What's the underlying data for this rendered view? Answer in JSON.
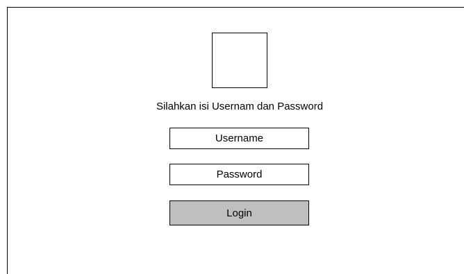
{
  "login_form": {
    "instruction": "Silahkan isi Usernam dan Password",
    "username_placeholder": "Username",
    "password_placeholder": "Password",
    "login_label": "Login"
  },
  "colors": {
    "border": "#000000",
    "background": "#ffffff",
    "button_fill": "#bfbfbf"
  }
}
